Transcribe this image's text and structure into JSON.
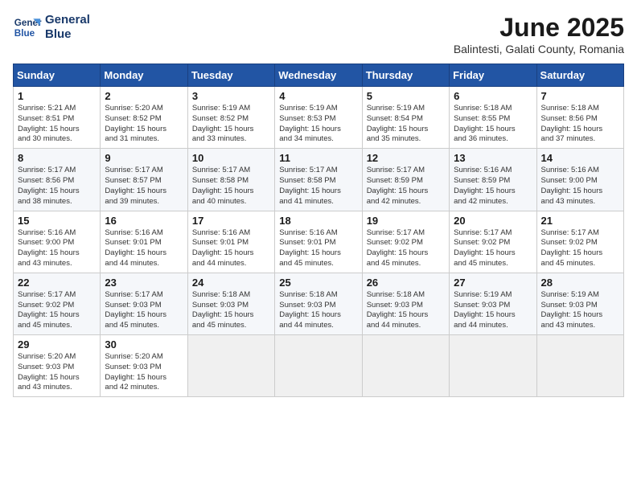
{
  "header": {
    "logo_line1": "General",
    "logo_line2": "Blue",
    "title": "June 2025",
    "subtitle": "Balintesti, Galati County, Romania"
  },
  "calendar": {
    "days_of_week": [
      "Sunday",
      "Monday",
      "Tuesday",
      "Wednesday",
      "Thursday",
      "Friday",
      "Saturday"
    ],
    "weeks": [
      [
        {
          "day": "",
          "info": ""
        },
        {
          "day": "",
          "info": ""
        },
        {
          "day": "",
          "info": ""
        },
        {
          "day": "",
          "info": ""
        },
        {
          "day": "",
          "info": ""
        },
        {
          "day": "",
          "info": ""
        },
        {
          "day": "",
          "info": ""
        }
      ]
    ],
    "cells": [
      {
        "day": "1",
        "info": "Sunrise: 5:21 AM\nSunset: 8:51 PM\nDaylight: 15 hours\nand 30 minutes."
      },
      {
        "day": "2",
        "info": "Sunrise: 5:20 AM\nSunset: 8:52 PM\nDaylight: 15 hours\nand 31 minutes."
      },
      {
        "day": "3",
        "info": "Sunrise: 5:19 AM\nSunset: 8:52 PM\nDaylight: 15 hours\nand 33 minutes."
      },
      {
        "day": "4",
        "info": "Sunrise: 5:19 AM\nSunset: 8:53 PM\nDaylight: 15 hours\nand 34 minutes."
      },
      {
        "day": "5",
        "info": "Sunrise: 5:19 AM\nSunset: 8:54 PM\nDaylight: 15 hours\nand 35 minutes."
      },
      {
        "day": "6",
        "info": "Sunrise: 5:18 AM\nSunset: 8:55 PM\nDaylight: 15 hours\nand 36 minutes."
      },
      {
        "day": "7",
        "info": "Sunrise: 5:18 AM\nSunset: 8:56 PM\nDaylight: 15 hours\nand 37 minutes."
      },
      {
        "day": "8",
        "info": "Sunrise: 5:17 AM\nSunset: 8:56 PM\nDaylight: 15 hours\nand 38 minutes."
      },
      {
        "day": "9",
        "info": "Sunrise: 5:17 AM\nSunset: 8:57 PM\nDaylight: 15 hours\nand 39 minutes."
      },
      {
        "day": "10",
        "info": "Sunrise: 5:17 AM\nSunset: 8:58 PM\nDaylight: 15 hours\nand 40 minutes."
      },
      {
        "day": "11",
        "info": "Sunrise: 5:17 AM\nSunset: 8:58 PM\nDaylight: 15 hours\nand 41 minutes."
      },
      {
        "day": "12",
        "info": "Sunrise: 5:17 AM\nSunset: 8:59 PM\nDaylight: 15 hours\nand 42 minutes."
      },
      {
        "day": "13",
        "info": "Sunrise: 5:16 AM\nSunset: 8:59 PM\nDaylight: 15 hours\nand 42 minutes."
      },
      {
        "day": "14",
        "info": "Sunrise: 5:16 AM\nSunset: 9:00 PM\nDaylight: 15 hours\nand 43 minutes."
      },
      {
        "day": "15",
        "info": "Sunrise: 5:16 AM\nSunset: 9:00 PM\nDaylight: 15 hours\nand 43 minutes."
      },
      {
        "day": "16",
        "info": "Sunrise: 5:16 AM\nSunset: 9:01 PM\nDaylight: 15 hours\nand 44 minutes."
      },
      {
        "day": "17",
        "info": "Sunrise: 5:16 AM\nSunset: 9:01 PM\nDaylight: 15 hours\nand 44 minutes."
      },
      {
        "day": "18",
        "info": "Sunrise: 5:16 AM\nSunset: 9:01 PM\nDaylight: 15 hours\nand 45 minutes."
      },
      {
        "day": "19",
        "info": "Sunrise: 5:17 AM\nSunset: 9:02 PM\nDaylight: 15 hours\nand 45 minutes."
      },
      {
        "day": "20",
        "info": "Sunrise: 5:17 AM\nSunset: 9:02 PM\nDaylight: 15 hours\nand 45 minutes."
      },
      {
        "day": "21",
        "info": "Sunrise: 5:17 AM\nSunset: 9:02 PM\nDaylight: 15 hours\nand 45 minutes."
      },
      {
        "day": "22",
        "info": "Sunrise: 5:17 AM\nSunset: 9:02 PM\nDaylight: 15 hours\nand 45 minutes."
      },
      {
        "day": "23",
        "info": "Sunrise: 5:17 AM\nSunset: 9:03 PM\nDaylight: 15 hours\nand 45 minutes."
      },
      {
        "day": "24",
        "info": "Sunrise: 5:18 AM\nSunset: 9:03 PM\nDaylight: 15 hours\nand 45 minutes."
      },
      {
        "day": "25",
        "info": "Sunrise: 5:18 AM\nSunset: 9:03 PM\nDaylight: 15 hours\nand 44 minutes."
      },
      {
        "day": "26",
        "info": "Sunrise: 5:18 AM\nSunset: 9:03 PM\nDaylight: 15 hours\nand 44 minutes."
      },
      {
        "day": "27",
        "info": "Sunrise: 5:19 AM\nSunset: 9:03 PM\nDaylight: 15 hours\nand 44 minutes."
      },
      {
        "day": "28",
        "info": "Sunrise: 5:19 AM\nSunset: 9:03 PM\nDaylight: 15 hours\nand 43 minutes."
      },
      {
        "day": "29",
        "info": "Sunrise: 5:20 AM\nSunset: 9:03 PM\nDaylight: 15 hours\nand 43 minutes."
      },
      {
        "day": "30",
        "info": "Sunrise: 5:20 AM\nSunset: 9:03 PM\nDaylight: 15 hours\nand 42 minutes."
      }
    ]
  }
}
